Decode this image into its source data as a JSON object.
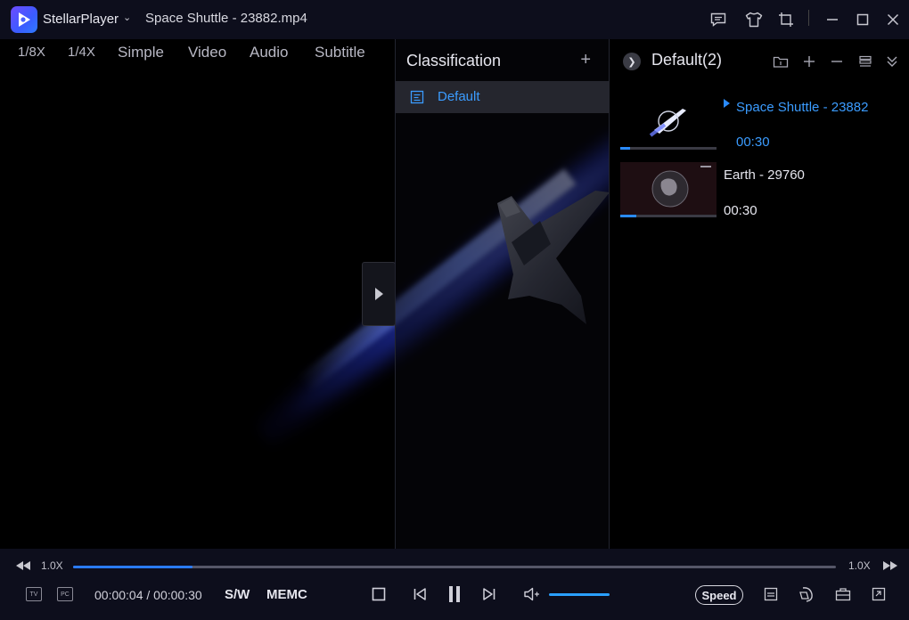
{
  "titlebar": {
    "app_name": "StellarPlayer",
    "file_title": "Space Shuttle - 23882.mp4"
  },
  "top_tabs": [
    "1/8X",
    "1/4X",
    "Simple",
    "Video",
    "Audio",
    "Subtitle"
  ],
  "classification": {
    "title": "Classification",
    "add_label": "+",
    "items": [
      {
        "label": "Default"
      }
    ]
  },
  "playlist": {
    "title": "Default(2)",
    "items": [
      {
        "name": "Space Shuttle - 23882",
        "duration": "00:30",
        "playing": true,
        "progress": 0.1
      },
      {
        "name": "Earth - 29760",
        "duration": "00:30",
        "playing": false,
        "progress": 0.17
      }
    ]
  },
  "controls": {
    "rate_left": "1.0X",
    "rate_right": "1.0X",
    "progress": 0.157,
    "time": "00:00:04 / 00:00:30",
    "sw_label": "S/W",
    "memc_label": "MEMC",
    "speed_label": "Speed",
    "tv_badge": "TV",
    "pc_badge": "PC",
    "volume": 1.0
  },
  "colors": {
    "accent": "#2a8bff",
    "titlebar_bg": "#0d0e1c",
    "active_item_bg": "#25262e"
  }
}
